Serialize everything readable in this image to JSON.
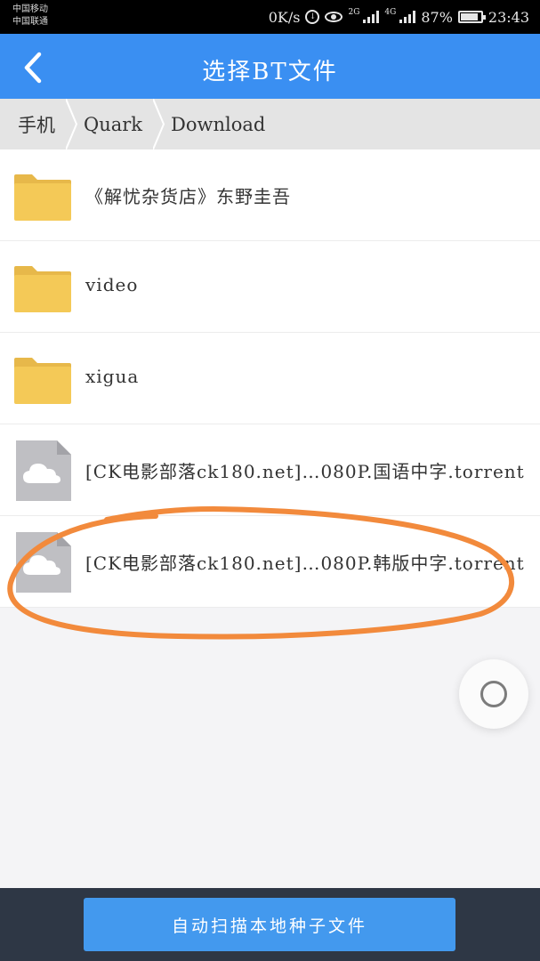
{
  "status_bar": {
    "carrier_1": "中国移动",
    "carrier_2": "中国联通",
    "speed": "0K/s",
    "net_2g": "2G",
    "net_4g": "4G",
    "battery": "87%",
    "time": "23:43"
  },
  "header": {
    "title": "选择BT文件",
    "back_icon": "chevron-left-icon",
    "background": "#3a8ff2"
  },
  "breadcrumb": {
    "items": [
      "手机",
      "Quark",
      "Download"
    ]
  },
  "list": {
    "items": [
      {
        "type": "folder",
        "label": "《解忧杂货店》东野圭吾"
      },
      {
        "type": "folder",
        "label": "video"
      },
      {
        "type": "folder",
        "label": "xigua"
      },
      {
        "type": "torrent",
        "label": "[CK电影部落ck180.net]…080P.国语中字.torrent"
      },
      {
        "type": "torrent",
        "label": "[CK电影部落ck180.net]…080P.韩版中字.torrent"
      }
    ]
  },
  "annotation": {
    "color": "#f28a3c"
  },
  "fab": {
    "icon": "circle-icon"
  },
  "bottom": {
    "scan_label": "自动扫描本地种子文件",
    "button_color": "#4399ee"
  }
}
